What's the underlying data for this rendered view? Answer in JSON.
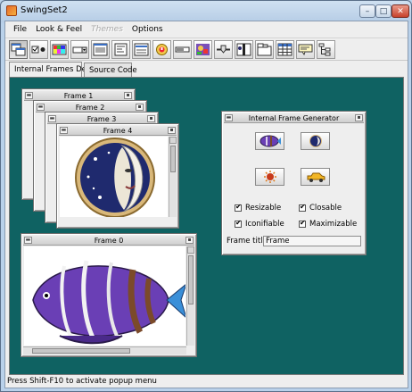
{
  "window": {
    "title": "SwingSet2",
    "minimize_glyph": "–",
    "maximize_glyph": "□",
    "close_glyph": "✕"
  },
  "menu": {
    "items": [
      {
        "label": "File",
        "disabled": false
      },
      {
        "label": "Look & Feel",
        "disabled": false
      },
      {
        "label": "Themes",
        "disabled": true
      },
      {
        "label": "Options",
        "disabled": false
      }
    ]
  },
  "toolbar": {
    "buttons": [
      {
        "icon": "internal-frames-icon",
        "selected": true
      },
      {
        "icon": "buttons-icon",
        "selected": false
      },
      {
        "icon": "color-chooser-icon",
        "selected": false
      },
      {
        "icon": "combobox-icon",
        "selected": false
      },
      {
        "icon": "file-chooser-icon",
        "selected": false
      },
      {
        "icon": "html-icon",
        "selected": false
      },
      {
        "icon": "list-icon",
        "selected": false
      },
      {
        "icon": "option-pane-icon",
        "selected": false
      },
      {
        "icon": "progress-bar-icon",
        "selected": false
      },
      {
        "icon": "scroll-pane-icon",
        "selected": false
      },
      {
        "icon": "slider-icon",
        "selected": false
      },
      {
        "icon": "split-pane-icon",
        "selected": false
      },
      {
        "icon": "tabbed-pane-icon",
        "selected": false
      },
      {
        "icon": "table-icon",
        "selected": false
      },
      {
        "icon": "tooltip-icon",
        "selected": false
      },
      {
        "icon": "tree-icon",
        "selected": false
      }
    ]
  },
  "tabs": [
    {
      "label": "Internal Frames Demo",
      "active": true
    },
    {
      "label": "Source Code",
      "active": false
    }
  ],
  "frames": {
    "frame1": {
      "title": "Frame 1"
    },
    "frame2": {
      "title": "Frame 2"
    },
    "frame3": {
      "title": "Frame 3"
    },
    "frame4": {
      "title": "Frame 4",
      "image": "moon-icon"
    },
    "frame0": {
      "title": "Frame 0",
      "image": "fish-icon"
    }
  },
  "generator": {
    "title": "Internal Frame Generator",
    "buttons": [
      {
        "icon": "fish-icon"
      },
      {
        "icon": "moon-icon"
      },
      {
        "icon": "sun-icon"
      },
      {
        "icon": "car-icon"
      }
    ],
    "checkboxes": {
      "resizable": {
        "label": "Resizable",
        "checked": true
      },
      "closable": {
        "label": "Closable",
        "checked": true
      },
      "iconifiable": {
        "label": "Iconifiable",
        "checked": true
      },
      "maximizable": {
        "label": "Maximizable",
        "checked": true
      }
    },
    "frame_title_label": "Frame title:",
    "frame_title_value": "Frame"
  },
  "status": {
    "text": "Press Shift-F10 to activate popup menu"
  },
  "colors": {
    "desktop": "#0f6262",
    "panel": "#eeeeee"
  }
}
